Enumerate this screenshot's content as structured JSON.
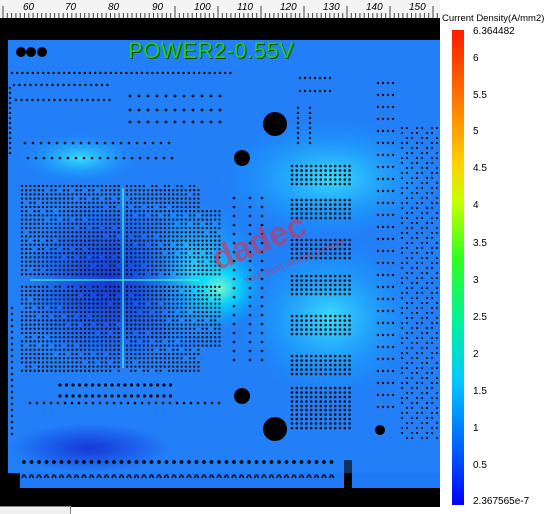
{
  "ruler": {
    "labels": [
      "60",
      "70",
      "80",
      "90",
      "100",
      "110",
      "120",
      "130",
      "140",
      "150"
    ]
  },
  "view": {
    "net_title": "POWER2-0.55V",
    "watermark": "dadec",
    "watermark_sub": "Your best design partner"
  },
  "legend": {
    "title": "Current Density(A/mm2)",
    "max_label": "6.364482",
    "min_label": "2.367565e-7",
    "ticks": [
      "6",
      "5.5",
      "5",
      "4.5",
      "4",
      "3.5",
      "3",
      "2.5",
      "2",
      "1.5",
      "1",
      "0.5"
    ],
    "colors": [
      "#0000ff",
      "#00c8ff",
      "#30ff20",
      "#ffd000",
      "#ff1a00"
    ]
  }
}
